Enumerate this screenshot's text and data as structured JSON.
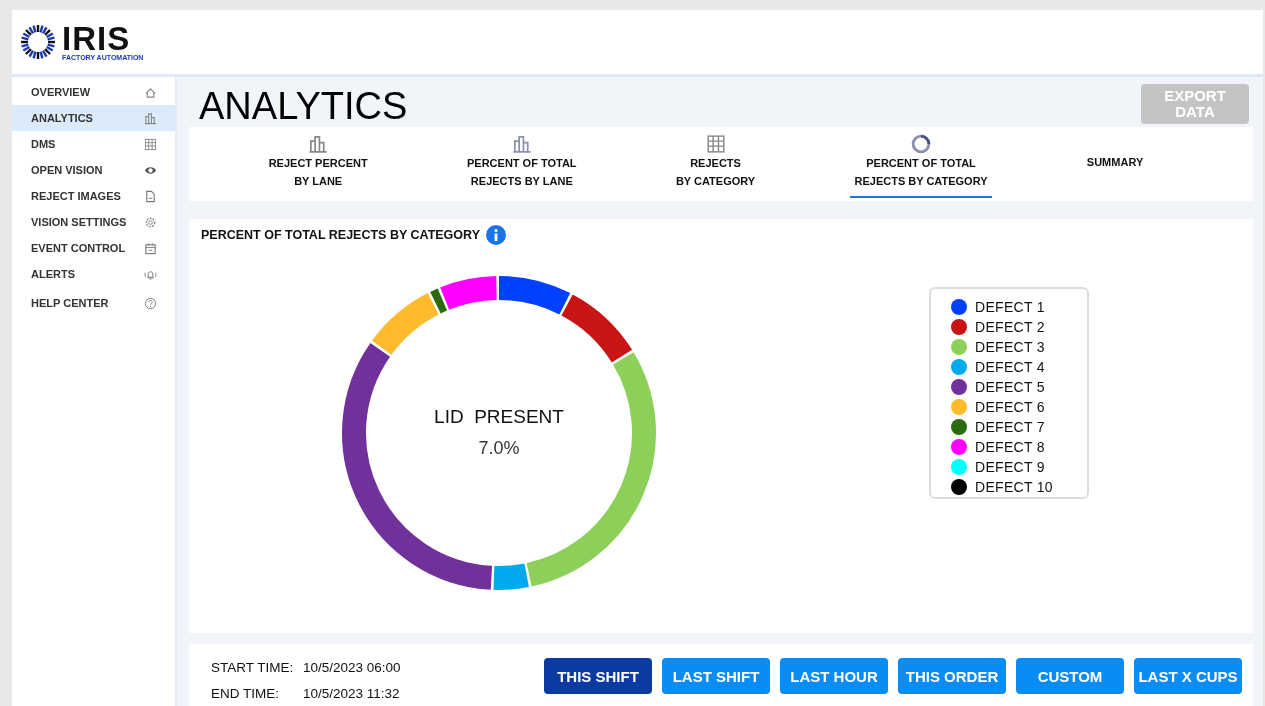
{
  "brand": {
    "name": "IRIS",
    "tagline": "FACTORY AUTOMATION"
  },
  "sidebar": {
    "items": [
      {
        "label": "OVERVIEW",
        "selected": false
      },
      {
        "label": "ANALYTICS",
        "selected": true
      },
      {
        "label": "DMS",
        "selected": false
      },
      {
        "label": "OPEN VISION",
        "selected": false
      },
      {
        "label": "REJECT IMAGES",
        "selected": false
      },
      {
        "label": "VISION SETTINGS",
        "selected": false
      },
      {
        "label": "EVENT CONTROL",
        "selected": false
      },
      {
        "label": "ALERTS",
        "selected": false
      },
      {
        "label": "HELP CENTER",
        "selected": false
      }
    ]
  },
  "page": {
    "title": "ANALYTICS",
    "export_button": "EXPORT\nDATA"
  },
  "tabs": [
    {
      "label": "REJECT PERCENT\nBY LANE",
      "selected": false
    },
    {
      "label": "PERCENT OF TOTAL\nREJECTS BY LANE",
      "selected": false
    },
    {
      "label": "REJECTS\nBY CATEGORY",
      "selected": false
    },
    {
      "label": "PERCENT OF TOTAL\nREJECTS BY CATEGORY",
      "selected": true
    },
    {
      "label": "SUMMARY",
      "selected": false
    }
  ],
  "chart": {
    "title": "PERCENT OF TOTAL REJECTS BY CATEGORY",
    "center_label": "LID  PRESENT",
    "center_value": "7.0%",
    "legend": [
      {
        "label": "DEFECT 1",
        "color": "#0041ff"
      },
      {
        "label": "DEFECT 2",
        "color": "#c81414"
      },
      {
        "label": "DEFECT 3",
        "color": "#8cd05a"
      },
      {
        "label": "DEFECT 4",
        "color": "#00aaee"
      },
      {
        "label": "DEFECT 5",
        "color": "#71319a"
      },
      {
        "label": "DEFECT 6",
        "color": "#ffbb2c"
      },
      {
        "label": "DEFECT 7",
        "color": "#2a6a10"
      },
      {
        "label": "DEFECT 8",
        "color": "#ff00ff"
      },
      {
        "label": "DEFECT 9",
        "color": "#00ffff"
      },
      {
        "label": "DEFECT 10",
        "color": "#000000"
      }
    ]
  },
  "time_range": {
    "start_label": "START TIME:",
    "start_value": "10/5/2023 06:00",
    "end_label": "END TIME:",
    "end_value": "10/5/2023 11:32"
  },
  "range_buttons": [
    {
      "label": "THIS SHIFT",
      "selected": true
    },
    {
      "label": "LAST SHIFT",
      "selected": false
    },
    {
      "label": "LAST HOUR",
      "selected": false
    },
    {
      "label": "THIS ORDER",
      "selected": false
    },
    {
      "label": "CUSTOM",
      "selected": false
    },
    {
      "label": "LAST X CUPS",
      "selected": false
    }
  ]
}
